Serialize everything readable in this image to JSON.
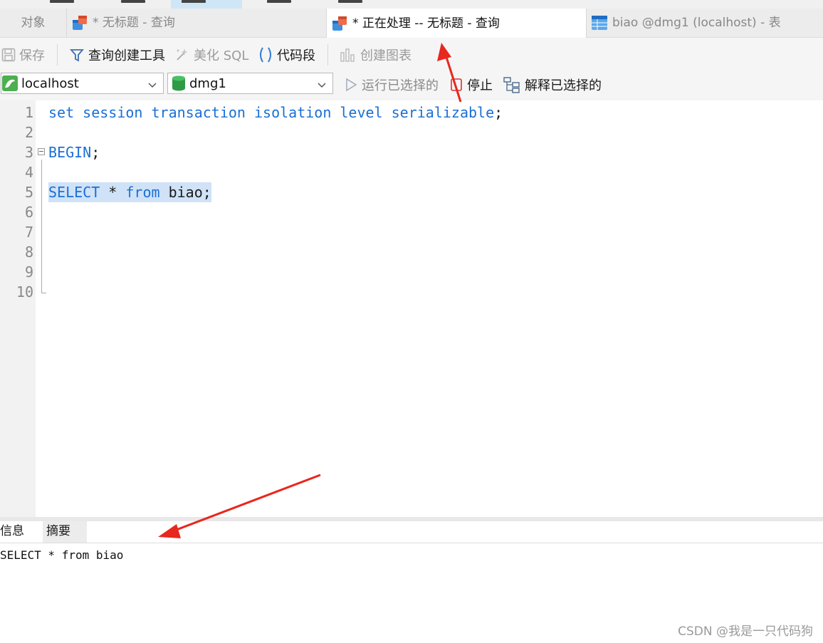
{
  "tabs": [
    {
      "label": "对象",
      "icon": "none"
    },
    {
      "label": "* 无标题 - 查询",
      "icon": "query-icon"
    },
    {
      "label": "* 正在处理 -- 无标题 - 查询",
      "icon": "query-icon"
    },
    {
      "label": "biao @dmg1 (localhost) - 表",
      "icon": "table-icon"
    }
  ],
  "toolbar": {
    "save_label": "保存",
    "query_builder_label": "查询创建工具",
    "beautify_sql_label": "美化 SQL",
    "code_snippet_label": "代码段",
    "create_chart_label": "创建图表"
  },
  "connection": {
    "host": "localhost",
    "database": "dmg1",
    "run_selected_label": "运行已选择的",
    "stop_label": "停止",
    "explain_selected_label": "解释已选择的"
  },
  "editor": {
    "lines": [
      {
        "num": "1",
        "text": "set session transaction isolation level serializable;"
      },
      {
        "num": "2",
        "text": ""
      },
      {
        "num": "3",
        "text": "BEGIN;"
      },
      {
        "num": "4",
        "text": ""
      },
      {
        "num": "5",
        "text": "SELECT * from biao;"
      },
      {
        "num": "6",
        "text": ""
      },
      {
        "num": "7",
        "text": ""
      },
      {
        "num": "8",
        "text": ""
      },
      {
        "num": "9",
        "text": ""
      },
      {
        "num": "10",
        "text": ""
      }
    ]
  },
  "bottom_panel": {
    "tabs": [
      "信息",
      "摘要"
    ],
    "output": "SELECT * from biao"
  },
  "watermark": "CSDN @我是一只代码狗",
  "colors": {
    "keyword": "#1a6fd6",
    "selection": "#cfe2f7",
    "annotation_arrow": "#e8271e"
  }
}
